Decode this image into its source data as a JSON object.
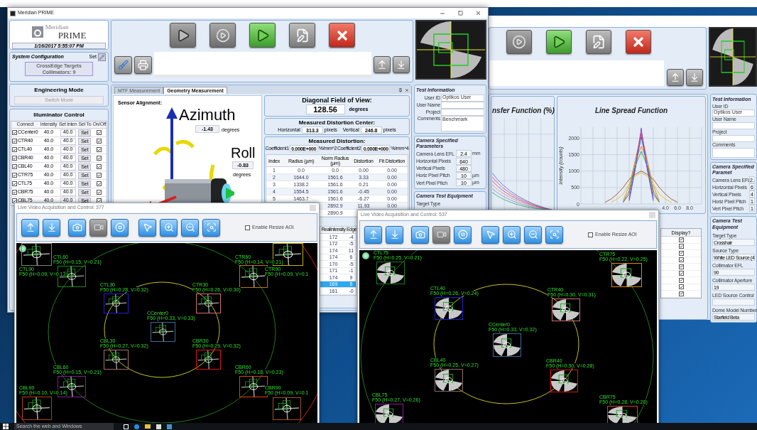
{
  "front_window": {
    "title": "Meridian PRIME",
    "logo": {
      "line1": "Meridian",
      "line2": "PRIME"
    },
    "datetime": "1/16/2017 5:55:07 PM",
    "toolbar": [
      {
        "kind": "play"
      },
      {
        "kind": "record"
      },
      {
        "kind": "run"
      },
      {
        "kind": "edit"
      },
      {
        "kind": "abort"
      }
    ],
    "tools": [
      {
        "kind": "clear"
      },
      {
        "kind": "print"
      }
    ],
    "transfer": [
      {
        "kind": "upload"
      },
      {
        "kind": "download"
      }
    ],
    "system_configuration": {
      "title": "System Configuration",
      "set_label": "Set",
      "targets": "CrossEdge Targets",
      "collimators": "Collimators: 9"
    },
    "engineering_mode": {
      "title": "Engineering Mode",
      "button": "Switch Mode"
    },
    "illuminator_control": {
      "title": "Illuminator Control",
      "columns": [
        "Connect",
        "Intensity",
        "Set Inten",
        "Set To",
        "On/Off"
      ],
      "rows": [
        {
          "name": "CCenter0",
          "connected": true,
          "intensity": "40.0",
          "set_value": "40.0",
          "button": "Set",
          "on": true
        },
        {
          "name": "CTR40",
          "connected": true,
          "intensity": "40.0",
          "set_value": "40.0",
          "button": "Set",
          "on": true
        },
        {
          "name": "CTL40",
          "connected": true,
          "intensity": "40.0",
          "set_value": "40.0",
          "button": "Set",
          "on": true
        },
        {
          "name": "CBR40",
          "connected": true,
          "intensity": "40.0",
          "set_value": "40.0",
          "button": "Set",
          "on": true
        },
        {
          "name": "CBL40",
          "connected": true,
          "intensity": "40.0",
          "set_value": "40.0",
          "button": "Set",
          "on": true
        },
        {
          "name": "CTR75",
          "connected": true,
          "intensity": "40.0",
          "set_value": "40.0",
          "button": "Set",
          "on": true
        },
        {
          "name": "CTL75",
          "connected": true,
          "intensity": "40.0",
          "set_value": "40.0",
          "button": "Set",
          "on": true
        },
        {
          "name": "CBR75",
          "connected": true,
          "intensity": "40.0",
          "set_value": "40.0",
          "button": "Set",
          "on": true
        },
        {
          "name": "CBL75",
          "connected": true,
          "intensity": "40.0",
          "set_value": "40.0",
          "button": "Set",
          "on": true
        }
      ]
    },
    "tabs": [
      {
        "label": "MTF Measurement",
        "selected": false
      },
      {
        "label": "Geometry Measurement",
        "selected": true
      }
    ],
    "sensor_alignment": {
      "title": "Sensor Alignment:",
      "azimuth_label": "Azimuth",
      "azimuth_value": "-1.43",
      "azimuth_unit": "degrees",
      "roll_label": "Roll",
      "roll_value": "-0.83",
      "roll_unit": "degrees"
    },
    "field_of_view": {
      "title": "Diagonal Field of View:",
      "value": "128.56",
      "unit": "degrees"
    },
    "distortion_center": {
      "title": "Measured Distortion Center:",
      "horizontal_label": "Horizontal",
      "horizontal_value": "313.3",
      "horizontal_unit": "pixels",
      "vertical_label": "Vertical",
      "vertical_value": "246.8",
      "vertical_unit": "pixels"
    },
    "distortion": {
      "title": "Measured Distortion:",
      "coefficient1_label": "Coefficient1",
      "coefficient1_value": "0.000E+000",
      "coefficient1_unit": "%/mm^2",
      "coefficient2_label": "Coefficient2",
      "coefficient2_value": "0.000E+000",
      "coefficient2_unit": "%/mm^4"
    },
    "distortion_table": {
      "columns": [
        "Index",
        "Radius (µm)",
        "Norm Radius (µm)",
        "Distortion",
        "Fit Distortion"
      ],
      "rows": [
        {
          "index": "1",
          "radius": "0.0",
          "norm_radius": "0.0",
          "distortion": "0.00",
          "fit": "0.00"
        },
        {
          "index": "2",
          "radius": "1644.0",
          "norm_radius": "1561.6",
          "distortion": "3.33",
          "fit": "0.00"
        },
        {
          "index": "3",
          "radius": "1338.2",
          "norm_radius": "1561.6",
          "distortion": "0.21",
          "fit": "0.00"
        },
        {
          "index": "4",
          "radius": "1554.5",
          "norm_radius": "1561.6",
          "distortion": "-0.45",
          "fit": "0.00"
        },
        {
          "index": "5",
          "radius": "1463.7",
          "norm_radius": "1561.6",
          "distortion": "-6.27",
          "fit": "0.00"
        },
        {
          "norm_radius": "2892.9",
          "distortion": "11.93",
          "fit": "0.00"
        },
        {
          "norm_radius": "2890.9"
        }
      ]
    },
    "intensity_table": {
      "columns": [
        "RealIntensity",
        "Edge"
      ],
      "rows": [
        {
          "values": [
            "172",
            "-4"
          ],
          "selected": false
        },
        {
          "values": [
            "172",
            "-5"
          ],
          "selected": false
        },
        {
          "values": [
            "174",
            "11"
          ],
          "selected": false
        },
        {
          "values": [
            "174",
            "6"
          ],
          "selected": false
        },
        {
          "values": [
            "170",
            "-5"
          ],
          "selected": false
        },
        {
          "values": [
            "171",
            "-1"
          ],
          "selected": false
        },
        {
          "values": [
            "174",
            "9"
          ],
          "selected": false
        },
        {
          "values": [
            "169",
            "5"
          ],
          "selected": true
        },
        {
          "values": [
            "161",
            "-0"
          ],
          "selected": false
        }
      ]
    },
    "test_information": {
      "title": "Test Information",
      "fields": [
        {
          "label": "User ID",
          "value": "Optikos User"
        },
        {
          "label": "User Name"
        },
        {
          "label": "Project"
        }
      ],
      "comments_label": "Comments",
      "comments_value": "Benchmark"
    },
    "camera_parameters": {
      "title": "Camera Specified Parameters",
      "rows": [
        {
          "label": "Camera Lens EFL",
          "value": "2.4",
          "unit": "mm"
        },
        {
          "label": "Horizontal Pixels",
          "value": "640"
        },
        {
          "label": "Vertical Pixels",
          "value": "480"
        },
        {
          "label": "Horiz Pixel Pitch",
          "value": "10",
          "unit": "µm"
        },
        {
          "label": "Vert Pixel Pitch",
          "value": "10",
          "unit": "µm"
        }
      ]
    },
    "camera_test_equipment": {
      "title": "Camera Test Equipment",
      "fields": [
        {
          "label": "Target Type"
        }
      ]
    }
  },
  "back_window": {
    "toolbar": [
      {
        "kind": "record"
      },
      {
        "kind": "run"
      },
      {
        "kind": "edit"
      },
      {
        "kind": "abort"
      }
    ],
    "transfer": [
      {
        "kind": "upload"
      },
      {
        "kind": "download"
      }
    ],
    "mtf_chart": {
      "title": "nsfer Function (%)"
    },
    "lsf_chart": {
      "chart_data": {
        "type": "line",
        "title": "Line Spread Function",
        "ylabel": "Intensity (counts)",
        "x": [
          -6,
          -5,
          -4,
          -3,
          -2,
          -1,
          0,
          1,
          2,
          3,
          4,
          5,
          6
        ],
        "xlim": [
          -10,
          10
        ],
        "ylim": [
          0,
          2333
        ],
        "xticks": [
          {
            "value": 4,
            "label": "4.0"
          },
          {
            "value": 6,
            "label": "6.0"
          },
          {
            "value": 8,
            "label": "8.0"
          }
        ],
        "yticks": [
          0,
          500,
          1000,
          1500,
          2000
        ],
        "grid": true,
        "series": [
          {
            "color": "#8030c0",
            "values": [
              null,
              null,
              null,
              null,
              100,
              1050,
              2300,
              1050,
              100,
              null,
              null,
              null,
              null
            ]
          },
          {
            "color": "#e03030",
            "values": [
              null,
              null,
              null,
              50,
              300,
              1300,
              2150,
              1300,
              300,
              50,
              null,
              null,
              null
            ]
          },
          {
            "color": "#f08020",
            "values": [
              null,
              null,
              null,
              100,
              550,
              1300,
              1750,
              1300,
              550,
              100,
              null,
              null,
              null
            ]
          },
          {
            "color": "#a05020",
            "values": [
              50,
              150,
              300,
              500,
              750,
              900,
              1000,
              900,
              750,
              500,
              300,
              150,
              50
            ]
          },
          {
            "color": "#e8c020",
            "values": [
              null,
              50,
              150,
              300,
              600,
              850,
              950,
              850,
              600,
              300,
              150,
              50,
              null
            ]
          },
          {
            "color": "#20a040",
            "values": [
              null,
              null,
              null,
              50,
              400,
              1150,
              1600,
              1150,
              400,
              50,
              null,
              null,
              null
            ]
          },
          {
            "color": "#3050e0",
            "values": [
              null,
              null,
              null,
              null,
              150,
              1100,
              2050,
              1100,
              150,
              null,
              null,
              null,
              null
            ]
          }
        ]
      }
    },
    "display_column": {
      "header": "Display?",
      "rows": [
        {
          "checked": true
        },
        {
          "checked": true
        },
        {
          "checked": true
        },
        {
          "checked": true
        },
        {
          "checked": true
        },
        {
          "checked": true
        },
        {
          "checked": true
        },
        {
          "checked": true
        },
        {
          "checked": true
        }
      ]
    },
    "test_information": {
      "title": "Test Information",
      "fields": [
        {
          "label": "User ID",
          "value": "Optikos User"
        },
        {
          "label": "User Name"
        },
        {
          "label": "Project"
        }
      ],
      "comments_label": "Comments"
    },
    "camera_parameters": {
      "title": "Camera Specified Paramet",
      "rows": [
        {
          "label": "Camera Lens EFL",
          "value": "2."
        },
        {
          "label": "Horizontal Pixels",
          "value": "6"
        },
        {
          "label": "Vertical Pixels",
          "value": "4"
        },
        {
          "label": "Horiz Pixel Pitch",
          "value": "1"
        },
        {
          "label": "Vert Pixel Pitch",
          "value": "1"
        }
      ]
    },
    "camera_test_equipment": {
      "title": "Camera Test Equipment",
      "fields": [
        {
          "label": "Target Type",
          "value": "Crosshair"
        },
        {
          "label": "Source Type",
          "value": "White LED Source (4"
        },
        {
          "label": "Collimator EFL",
          "value": "90"
        },
        {
          "label": "Collimator Aperture",
          "value": "19"
        },
        {
          "label": "LED Source Control"
        },
        {
          "label": "Dome Model Number",
          "value": "Starfield Beta"
        }
      ]
    }
  },
  "live_windows": [
    {
      "title": "Live Video Acquisition and Control: 377",
      "kind": "crosshair",
      "resize_label": "Enable Resize AOI",
      "resize_checked": false,
      "toolbar": [
        {
          "kind": "upload",
          "disabled": false
        },
        {
          "kind": "download",
          "disabled": false
        },
        {
          "kind": "snapshot",
          "disabled": false
        },
        {
          "kind": "record",
          "disabled": true
        },
        {
          "kind": "stop",
          "disabled": false
        },
        {
          "kind": "select",
          "disabled": false
        },
        {
          "kind": "zoom_in",
          "disabled": false
        },
        {
          "kind": "zoom_out",
          "disabled": false
        },
        {
          "kind": "zoom_fit",
          "disabled": false
        }
      ],
      "targets": [
        {
          "name": "CTL60",
          "reading": "F50 (H=0.15, V=0.21)",
          "color": "#1a8a1a"
        },
        {
          "name": "CTL90",
          "reading": "F50 (H=0.09, V=0.13)",
          "color": "#808080"
        },
        {
          "name": "CTR60",
          "reading": "F50 (H=0.14, V=0.21)",
          "color": "#c07800"
        },
        {
          "name": "CTR90",
          "reading": "F50 (H=0.09, V=0.1",
          "color": "#c8b400"
        },
        {
          "name": "CTL30",
          "reading": "F50 (H=0.28, V=0.32)",
          "color": "#2020d0"
        },
        {
          "name": "CTR30",
          "reading": "F50 (H=0.26, V=0.30)",
          "color": "#d07070"
        },
        {
          "name": "CCenter0",
          "reading": "F50 (H=0.33, V=0.33)",
          "color": "#3a6a9a"
        },
        {
          "name": "CBL30",
          "reading": "F50 (H=0.27, V=0.32)",
          "color": "#a07070"
        },
        {
          "name": "CBR30",
          "reading": "F50 (H=0.29, V=0.32)",
          "color": "#e01010"
        },
        {
          "name": "CBL60",
          "reading": "F50 (H=0.15, V=0.21)",
          "color": "#8a1a9a"
        },
        {
          "name": "CBR60",
          "reading": "F50 (H=0.18, V=0.23)",
          "color": "#e04010"
        },
        {
          "name": "CBL90",
          "reading": "F50 (H=0.10, V=0.14)",
          "color": "#b04020"
        },
        {
          "name": "CBR90",
          "reading": "F50 (H=0.09, V=0.1",
          "color": "#a05020"
        }
      ]
    },
    {
      "title": "Live Video Acquisition and Control: 537",
      "kind": "sector",
      "resize_label": "Enable Resize AOI",
      "resize_checked": false,
      "toolbar": [
        {
          "kind": "upload",
          "disabled": false
        },
        {
          "kind": "download",
          "disabled": false
        },
        {
          "kind": "snapshot",
          "disabled": false
        },
        {
          "kind": "record",
          "disabled": true
        },
        {
          "kind": "stop",
          "disabled": false
        },
        {
          "kind": "select",
          "disabled": false
        },
        {
          "kind": "zoom_in",
          "disabled": false
        },
        {
          "kind": "zoom_out",
          "disabled": false
        },
        {
          "kind": "zoom_fit",
          "disabled": false
        }
      ],
      "targets": [
        {
          "name": "CTL75",
          "reading": "F50 (H=0.25, V=0.21)",
          "color": "#1a7a1a"
        },
        {
          "name": "CTR75",
          "reading": "F50 (H=0.22, V=0.25)",
          "color": "#e08a00"
        },
        {
          "name": "CTL40",
          "reading": "F50 (H=0.26, V=0.24)",
          "color": "#2020d0"
        },
        {
          "name": "CTR40",
          "reading": "F50 (H=0.30, V=0.31)",
          "color": "#d07070"
        },
        {
          "name": "CCenter0",
          "reading": "F50 (H=0.33, V=0.32)",
          "color": "#3a6a9a"
        },
        {
          "name": "CBL40",
          "reading": "F50 (H=0.25, V=0.27)",
          "color": "#8a6a6a"
        },
        {
          "name": "CBR40",
          "reading": "F50 (H=0.30, V=0.28)",
          "color": "#e01010"
        },
        {
          "name": "CBL75",
          "reading": "F50 (H=0.27, V=0.26)",
          "color": "#8a1a9a"
        },
        {
          "name": "CBR75",
          "reading": "F50 (H=0.28, V=0.28)",
          "color": "#e04010"
        }
      ]
    }
  ],
  "taskbar": {
    "search_placeholder": "Search the web and Windows"
  }
}
